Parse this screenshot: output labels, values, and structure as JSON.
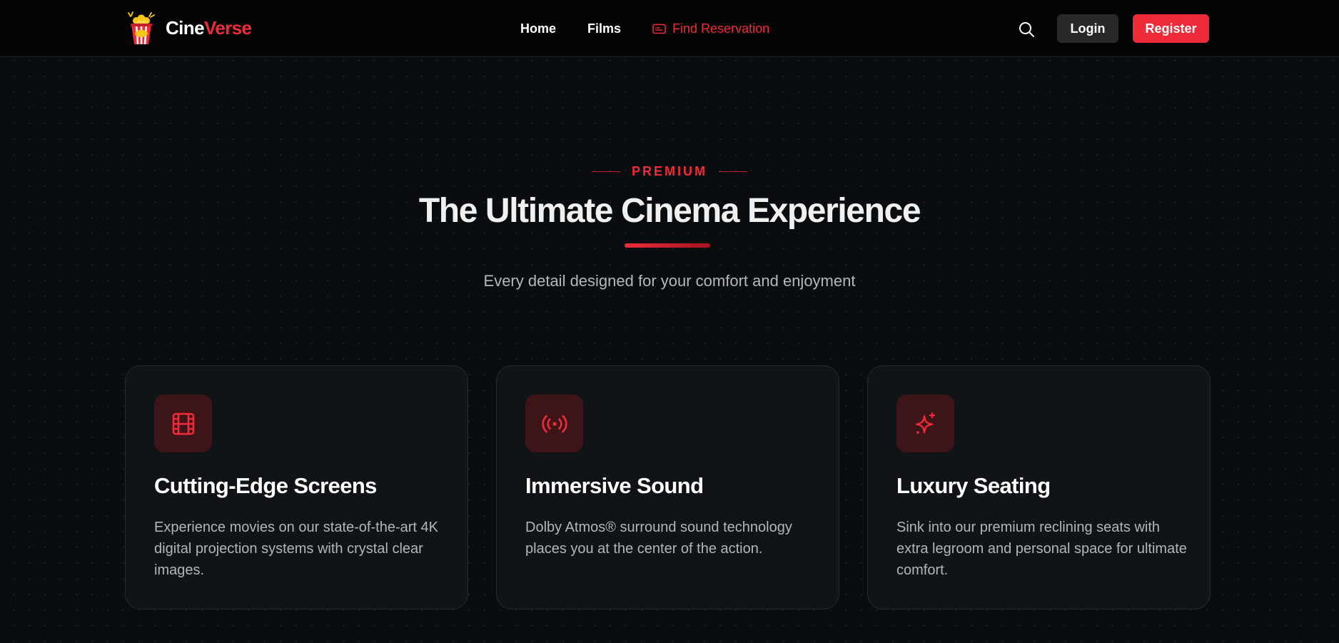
{
  "brand": {
    "name_part1": "Cine",
    "name_part2": "Verse",
    "logo_icon": "popcorn-icon"
  },
  "nav": {
    "items": [
      {
        "label": "Home",
        "active": false
      },
      {
        "label": "Films",
        "active": false
      },
      {
        "label": "Find Reservation",
        "active": true,
        "icon": "ticket-icon"
      }
    ],
    "search_icon": "search-icon",
    "login_label": "Login",
    "register_label": "Register"
  },
  "hero": {
    "eyebrow": "PREMIUM",
    "title": "The Ultimate Cinema Experience",
    "subtitle": "Every detail designed for your comfort and enjoyment"
  },
  "features": [
    {
      "icon": "film-icon",
      "title": "Cutting-Edge Screens",
      "description": "Experience movies on our state-of-the-art 4K digital projection systems with crystal clear images."
    },
    {
      "icon": "sound-waves-icon",
      "title": "Immersive Sound",
      "description": "Dolby Atmos® surround sound technology places you at the center of the action."
    },
    {
      "icon": "sparkles-icon",
      "title": "Luxury Seating",
      "description": "Sink into our premium reclining seats with extra legroom and personal space for ultimate comfort."
    }
  ],
  "colors": {
    "accent": "#ef2b3a",
    "background": "#0a0d10",
    "navbar": "#050505",
    "card": "#111416",
    "icon_tile": "#3d1518",
    "login_button": "#27292b"
  }
}
